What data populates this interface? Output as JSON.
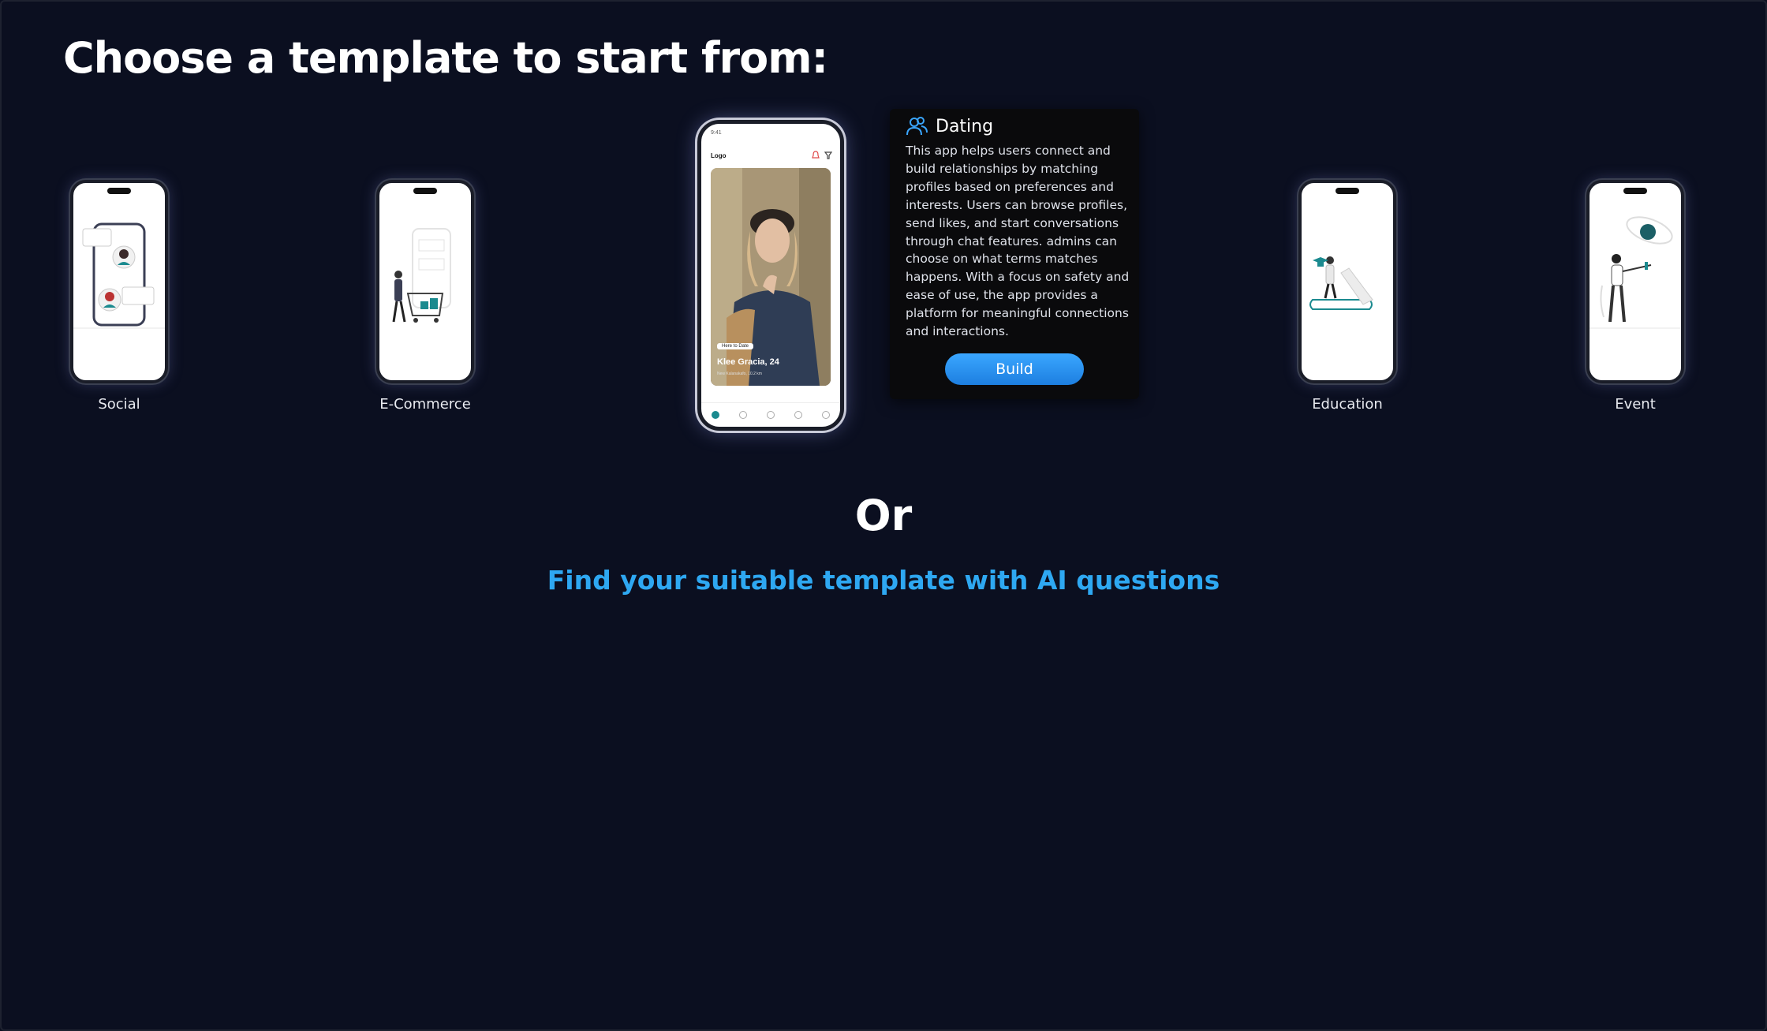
{
  "page": {
    "title": "Choose a template to start from:"
  },
  "templates": [
    {
      "label": "Social",
      "icon": "social-illustration-icon"
    },
    {
      "label": "E-Commerce",
      "icon": "ecommerce-illustration-icon"
    },
    {
      "label": "Education",
      "icon": "education-illustration-icon"
    },
    {
      "label": "Event",
      "icon": "event-illustration-icon"
    }
  ],
  "featured": {
    "screen": {
      "status_time": "9:41",
      "logo": "Logo",
      "chip": "Here to Date",
      "profile_name": "Klee Gracia, 24",
      "location": "New Kalanakafo, 10.2 km"
    },
    "card": {
      "icon": "users-icon",
      "title": "Dating",
      "description": "This app helps users connect and build relationships by matching profiles based on preferences and interests. Users can browse profiles, send likes, and start conversations through chat features. admins can choose on what terms matches happens. With a focus on safety and ease of use, the app provides a platform for meaningful connections and interactions.",
      "button": "Build"
    }
  },
  "alt": {
    "or": "Or",
    "ai_link": "Find your suitable template with AI questions"
  },
  "colors": {
    "background": "#0b0f20",
    "accent": "#2ea8f2",
    "button": "#1d7fe0",
    "teal": "#1b8a8f"
  }
}
